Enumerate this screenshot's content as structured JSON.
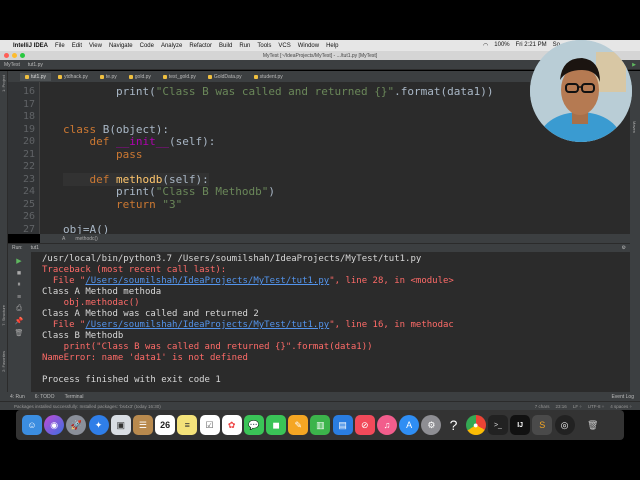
{
  "menubar": {
    "app_name": "IntelliJ IDEA",
    "items": [
      "File",
      "Edit",
      "View",
      "Navigate",
      "Code",
      "Analyze",
      "Refactor",
      "Build",
      "Run",
      "Tools",
      "VCS",
      "Window",
      "Help"
    ],
    "battery": "100%",
    "clock": "Fri 2:21 PM",
    "user": "So"
  },
  "window": {
    "title": "MyTest [~/IdeaProjects/MyTest] - .../tut1.py [MyTest]"
  },
  "navbar": {
    "project": "MyTest",
    "file": "tut1.py"
  },
  "tabs": [
    "tut1.py",
    "ytdhack.py",
    "te.py",
    "gold.py",
    "test_gold.py",
    "GoldData.py",
    "student.py"
  ],
  "sidebar": {
    "project_label": "1: Project",
    "structure_label": "7: Structure",
    "favorites_label": "2: Favorites",
    "maven_label": "Maven"
  },
  "editor": {
    "line_numbers": [
      "16",
      "17",
      "18",
      "19",
      "20",
      "21",
      "22",
      "23",
      "24",
      "25",
      "26",
      "27"
    ],
    "lines": {
      "l16_indent": "        ",
      "l16_print": "print",
      "l16_str": "\"Class B was called and returned {}\"",
      "l16_rest": ".format(data1))",
      "l19_kw": "class ",
      "l19_rest": "B(object):",
      "l20_kw": "def ",
      "l20_fn": "__init__",
      "l20_rest": "(self):",
      "l21_kw": "pass",
      "l23_kw": "def ",
      "l23_fn": "methodb",
      "l23_rest": "(self):",
      "l24_print": "print(",
      "l24_str": "\"Class B Methodb\"",
      "l24_rest": ")",
      "l25_kw": "return ",
      "l25_str": "\"3\"",
      "l27": "obj=A()"
    }
  },
  "breadcrumb": {
    "class": "A",
    "method": "methodc()"
  },
  "run": {
    "header_label": "Run:",
    "config_name": "tut1",
    "console": [
      {
        "text": "/usr/local/bin/python3.7 /Users/soumilshah/IdeaProjects/MyTest/tut1.py",
        "kind": "norm"
      },
      {
        "text": "Traceback (most recent call last):",
        "kind": "err"
      },
      {
        "text_pre": "  File \"",
        "link": "/Users/soumilshah/IdeaProjects/MyTest/tut1.py",
        "text_post": "\", line 28, in <module>",
        "kind": "err"
      },
      {
        "text": "Class A Method methoda",
        "kind": "norm"
      },
      {
        "text": "    obj.methodac()",
        "kind": "err"
      },
      {
        "text": "Class A Method was called and returned 2",
        "kind": "norm"
      },
      {
        "text_pre": "  File \"",
        "link": "/Users/soumilshah/IdeaProjects/MyTest/tut1.py",
        "text_post": "\", line 16, in methodac",
        "kind": "err"
      },
      {
        "text": "Class B Methodb",
        "kind": "norm"
      },
      {
        "text": "    print(\"Class B was called and returned {}\".format(data1))",
        "kind": "err"
      },
      {
        "text": "NameError: name 'data1' is not defined",
        "kind": "err"
      },
      {
        "text": "",
        "kind": "norm"
      },
      {
        "text": "Process finished with exit code 1",
        "kind": "norm"
      }
    ]
  },
  "bottom_tabs": {
    "run": "4: Run",
    "todo": "6: TODO",
    "terminal": "Terminal",
    "event_log": "Event Log"
  },
  "statusbar": {
    "message": "Packages installed successfully: Installed packages: 'bs4x3' (today 16:30)",
    "chars": "7 chars",
    "position": "23:16",
    "line_sep": "LF ÷",
    "encoding": "UTF-8 ÷",
    "indent": "4 spaces ÷"
  },
  "dock": {
    "calendar_day": "26",
    "icons": [
      "finder-icon",
      "siri-icon",
      "launchpad-icon",
      "safari-icon",
      "preview-icon",
      "contacts-icon",
      "calendar-icon",
      "notes-icon",
      "reminders-icon",
      "photos-icon",
      "messages-icon",
      "facetime-icon",
      "pages-icon",
      "numbers-icon",
      "keynote-icon",
      "news-icon",
      "music-icon",
      "appstore-icon",
      "settings-icon",
      "help-icon",
      "chrome-icon",
      "terminal-icon",
      "intellij-icon",
      "sublime-icon",
      "obs-icon",
      "trash-icon"
    ]
  },
  "colors": {
    "editor_bg": "#2b2b2b",
    "keyword": "#cc7832",
    "string": "#6a8759",
    "error": "#ff6b68",
    "link": "#5394ec"
  }
}
